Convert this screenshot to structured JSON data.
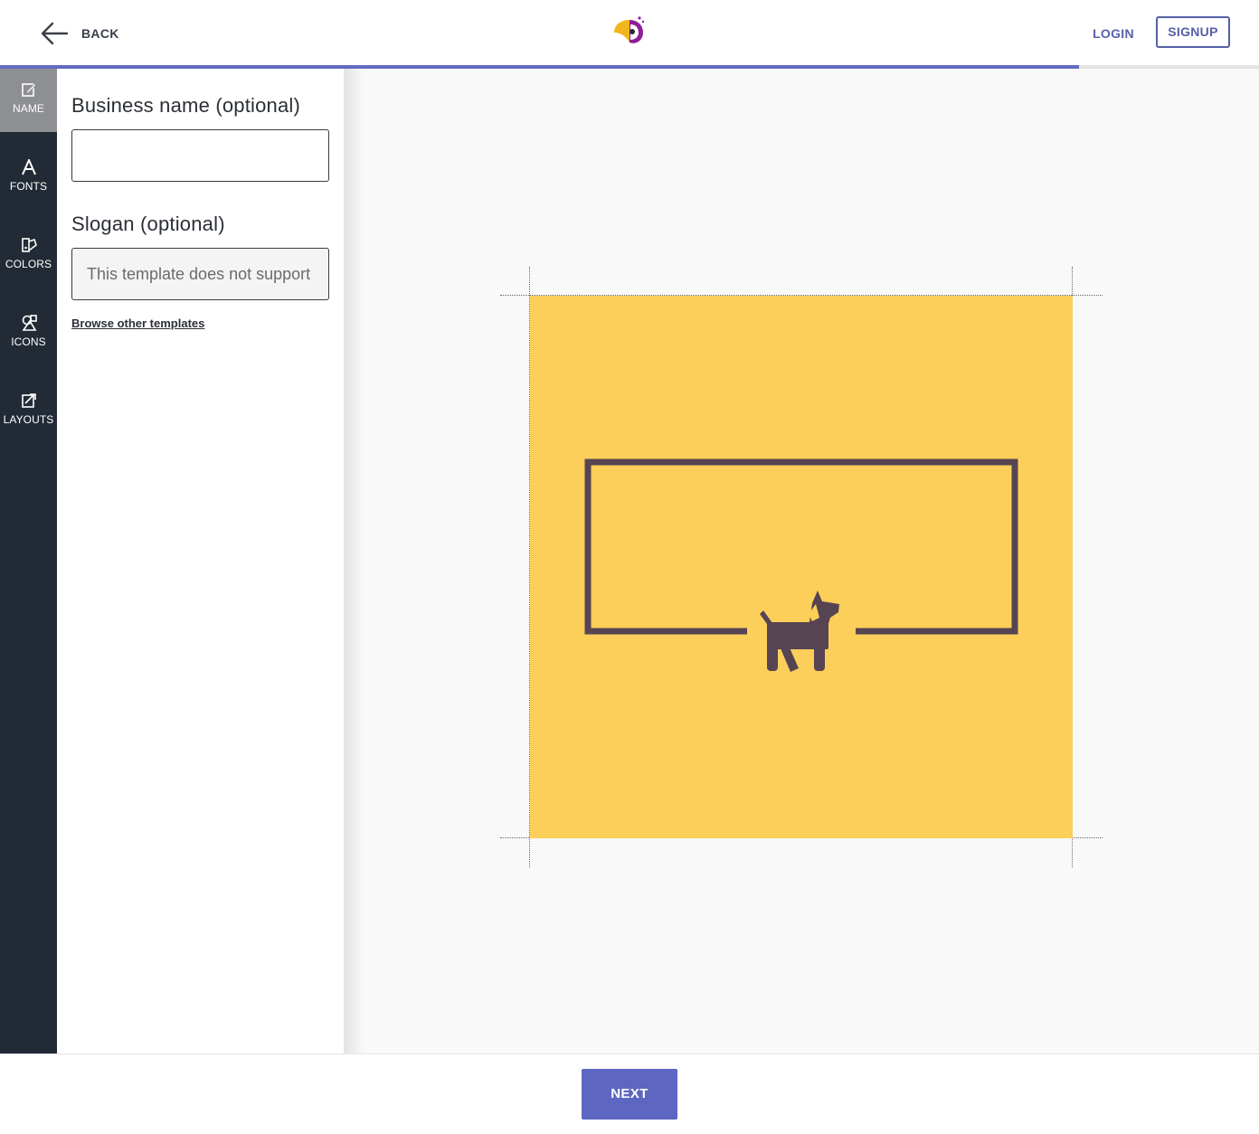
{
  "header": {
    "back_label": "BACK",
    "logo_icon": "parrot-logo-icon",
    "login_label": "LOGIN",
    "signup_label": "SIGNUP"
  },
  "progress": {
    "fraction": 0.857,
    "color": "#636bc1"
  },
  "sidebar": {
    "items": [
      {
        "label": "NAME",
        "icon": "edit-icon",
        "active": true
      },
      {
        "label": "FONTS",
        "icon": "font-icon",
        "active": false
      },
      {
        "label": "COLORS",
        "icon": "palette-icon",
        "active": false
      },
      {
        "label": "ICONS",
        "icon": "shapes-icon",
        "active": false
      },
      {
        "label": "LAYOUTS",
        "icon": "layout-icon",
        "active": false
      }
    ]
  },
  "form": {
    "business_name": {
      "label": "Business name (optional)",
      "value": ""
    },
    "slogan": {
      "label": "Slogan (optional)",
      "placeholder": "This template does not support slogans",
      "disabled": true
    },
    "browse_link": "Browse other templates"
  },
  "preview": {
    "background_color": "#fbcf5a",
    "foreground_color": "#574452",
    "icon": "dog-icon"
  },
  "footer": {
    "next_label": "NEXT",
    "accent": "#5d66c0"
  }
}
